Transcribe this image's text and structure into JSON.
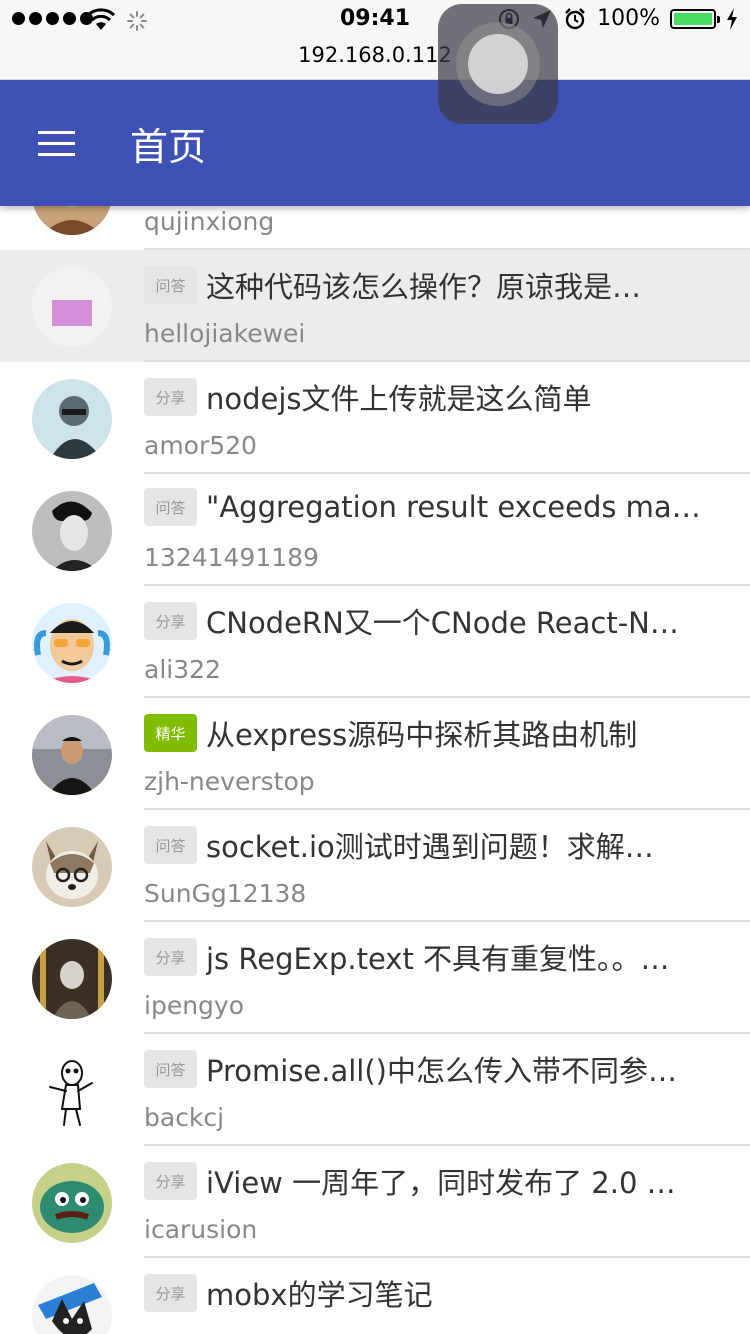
{
  "status_bar": {
    "time": "09:41",
    "url": "192.168.0.112",
    "battery": "100%",
    "battery_level": 1.0
  },
  "app_bar": {
    "title": "首页"
  },
  "colors": {
    "app_bar": "#3f51b5",
    "tag_default": "#e5e5e5",
    "tag_good": "#80bd01",
    "battery_fill": "#4cd964"
  },
  "topics": [
    {
      "tag": "",
      "title": "",
      "author": "qujinxiong",
      "avatar": "avatar-partial"
    },
    {
      "tag": "问答",
      "title": "这种代码该怎么操作？原谅我是…",
      "author": "hellojiakewei",
      "avatar": "avatar-placeholder"
    },
    {
      "tag": "分享",
      "title": "nodejs文件上传就是这么简单",
      "author": "amor520",
      "avatar": "avatar-photo"
    },
    {
      "tag": "问答",
      "title": "\"Aggregation result exceeds ma…",
      "author": "13241491189",
      "avatar": "avatar-photo"
    },
    {
      "tag": "分享",
      "title": "CNodeRN又一个CNode React-N…",
      "author": "ali322",
      "avatar": "avatar-cartoon"
    },
    {
      "tag": "精华",
      "title": "从express源码中探析其路由机制",
      "author": "zjh-neverstop",
      "avatar": "avatar-photo"
    },
    {
      "tag": "问答",
      "title": "socket.io测试时遇到问题！求解…",
      "author": "SunGg12138",
      "avatar": "avatar-dog"
    },
    {
      "tag": "分享",
      "title": "js RegExp.text 不具有重复性。。…",
      "author": "ipengyo",
      "avatar": "avatar-photo"
    },
    {
      "tag": "问答",
      "title": "Promise.all()中怎么传入带不同参…",
      "author": "backcj",
      "avatar": "avatar-sketch"
    },
    {
      "tag": "分享",
      "title": "iView 一周年了，同时发布了 2.0 …",
      "author": "icarusion",
      "avatar": "avatar-monster"
    },
    {
      "tag": "分享",
      "title": "mobx的学习笔记",
      "author": "",
      "avatar": "avatar-cat"
    }
  ]
}
